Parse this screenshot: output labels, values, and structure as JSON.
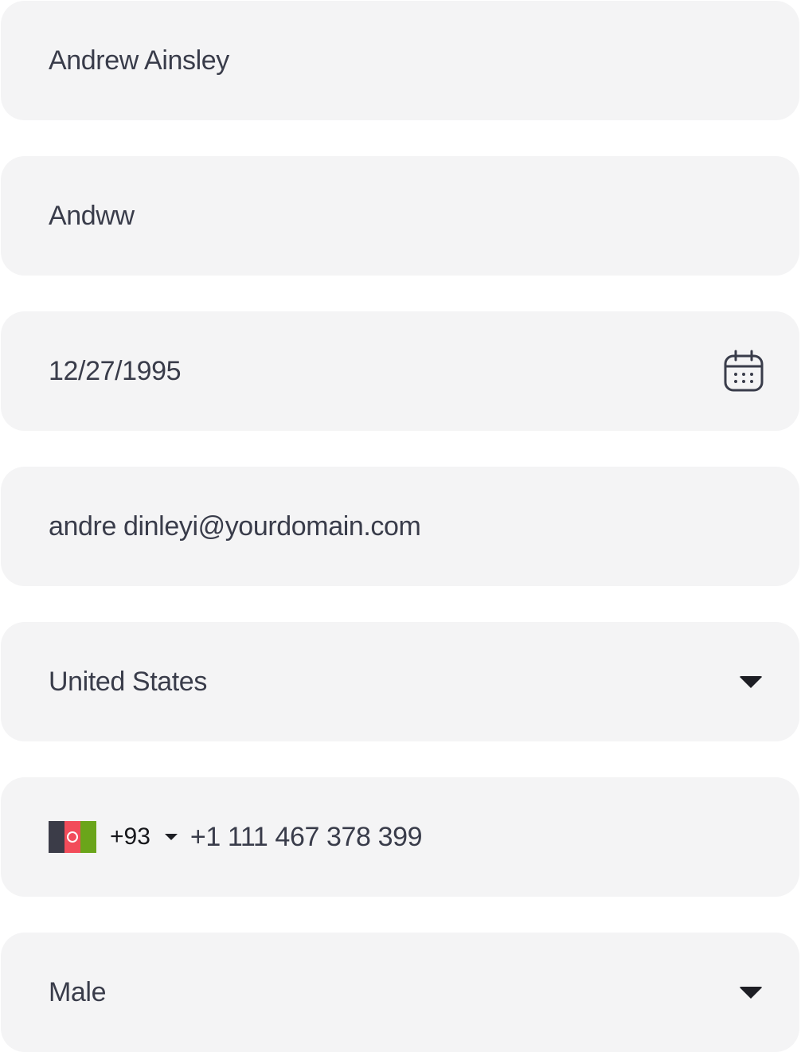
{
  "form": {
    "full_name": "Andrew Ainsley",
    "nickname": "Andww",
    "date_of_birth": "12/27/1995",
    "email": "andre dinleyi@yourdomain.com",
    "country": "United States",
    "phone": {
      "dial_code": "+93",
      "number": "+1 111 467 378 399",
      "flag_icon": "afghanistan-flag-icon"
    },
    "gender": "Male"
  },
  "icons": {
    "date": "calendar-icon",
    "country_dropdown": "caret-down-icon",
    "dial_dropdown": "caret-down-icon",
    "gender_dropdown": "caret-down-icon"
  },
  "colors": {
    "field_background": "#f4f4f5",
    "text": "#393c4a",
    "icon": "#1d1e24"
  }
}
